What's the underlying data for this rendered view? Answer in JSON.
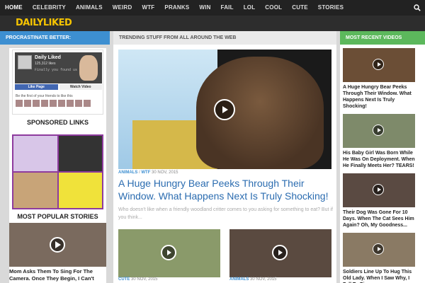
{
  "nav": {
    "items": [
      "HOME",
      "CELEBRITY",
      "ANIMALS",
      "WEIRD",
      "WTF",
      "PRANKS",
      "WIN",
      "FAIL",
      "LOL",
      "COOL",
      "CUTE",
      "STORIES"
    ],
    "search_icon": "search-icon"
  },
  "logo": {
    "part1": "DAILY",
    "part2": "LIKED"
  },
  "headers": {
    "left": "PROCRASTINATE BETTER:",
    "mid": "TRENDING STUFF FROM ALL AROUND THE WEB",
    "right": "MOST RECENT VIDEOS"
  },
  "facebook": {
    "page_name": "Daily Liked",
    "likes": "125,312 likes",
    "tagline": "Finally you found us",
    "like_button": "Like Page",
    "watch_button": "Watch Video",
    "friends_text": "Be the first of your friends to like this"
  },
  "sponsored_title": "SPONSORED LINKS",
  "popular": {
    "title": "MOST POPULAR STORIES",
    "caption": "Mom Asks Them To Sing For The Camera. Once They Begin, I Can't Look"
  },
  "hero": {
    "categories": [
      "ANIMALS",
      "WTF"
    ],
    "date": "30 NOV, 2015",
    "title": "A Huge Hungry Bear Peeks Through Their Window. What Happens Next Is Truly Shocking!",
    "excerpt": "Who doesn't like when a friendly woodland critter comes to you asking for something to eat? But if you think..."
  },
  "cards": [
    {
      "category": "CUTE",
      "date": "30 NOV, 2015"
    },
    {
      "category": "ANIMALS",
      "date": "30 NOV, 2015"
    }
  ],
  "recent": [
    {
      "caption": "A Huge Hungry Bear Peeks Through Their Window. What Happens Next Is Truly Shocking!"
    },
    {
      "caption": "His Baby Girl Was Born While He Was On Deployment. When He Finally Meets Her? TEARS!"
    },
    {
      "caption": "Their Dog Was Gone For 10 Days. When The Cat Sees Him Again? Oh, My Goodness..."
    },
    {
      "caption": "Soldiers Line Up To Hug This Old Lady. When I Saw Why, I Fell To Pieces."
    }
  ]
}
